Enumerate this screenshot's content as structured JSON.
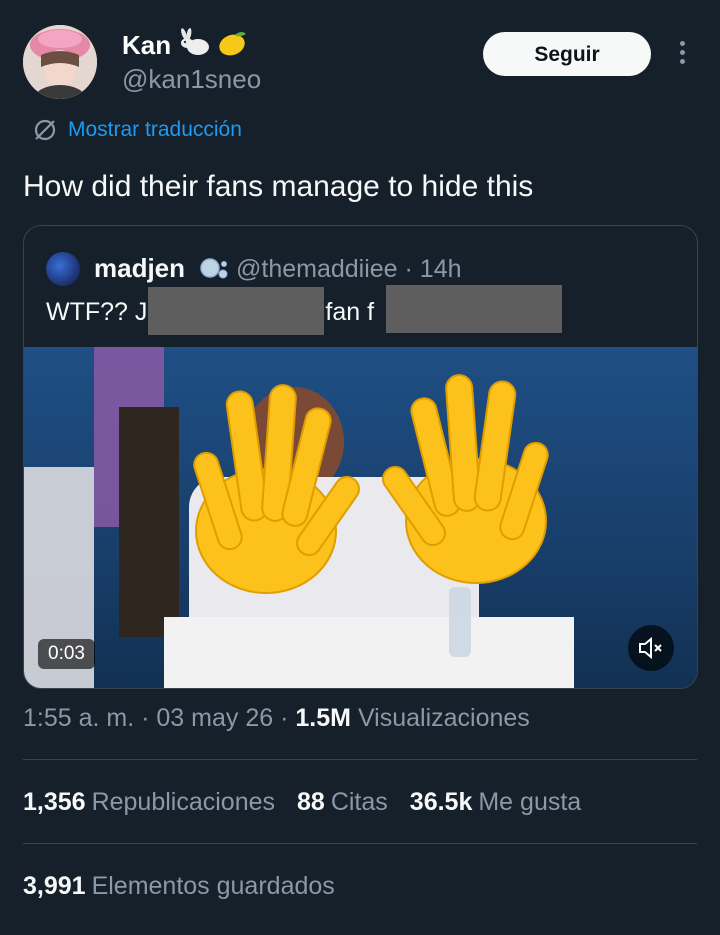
{
  "author": {
    "display_name": "Kan",
    "handle": "@kan1sneo",
    "name_emojis": [
      "rabbit-icon",
      "lemon-icon"
    ]
  },
  "follow_label": "Seguir",
  "translate_label": "Mostrar traducción",
  "tweet_text": "How did their fans manage to hide this",
  "quoted": {
    "name": "madjen",
    "handle_time": "@themaddiiee · 14h",
    "text_parts": [
      "WTF?? J",
      "fan f",
      "!"
    ]
  },
  "video": {
    "time": "0:03",
    "overlay_icons": [
      "raised-hand-icon",
      "raised-hand-icon"
    ]
  },
  "meta": {
    "time": "1:55 a. m.",
    "date": "03 may 26",
    "views": "1.5M",
    "views_label": "Visualizaciones"
  },
  "stats": {
    "reposts": "1,356",
    "reposts_label": "Republicaciones",
    "quotes": "88",
    "quotes_label": "Citas",
    "likes": "36.5k",
    "likes_label": "Me gusta",
    "bookmarks": "3,991",
    "bookmarks_label": "Elementos guardados"
  },
  "colors": {
    "background": "#15202b",
    "accent": "#1d9bf0",
    "muted": "#8b98a5",
    "divider": "#38444d"
  }
}
